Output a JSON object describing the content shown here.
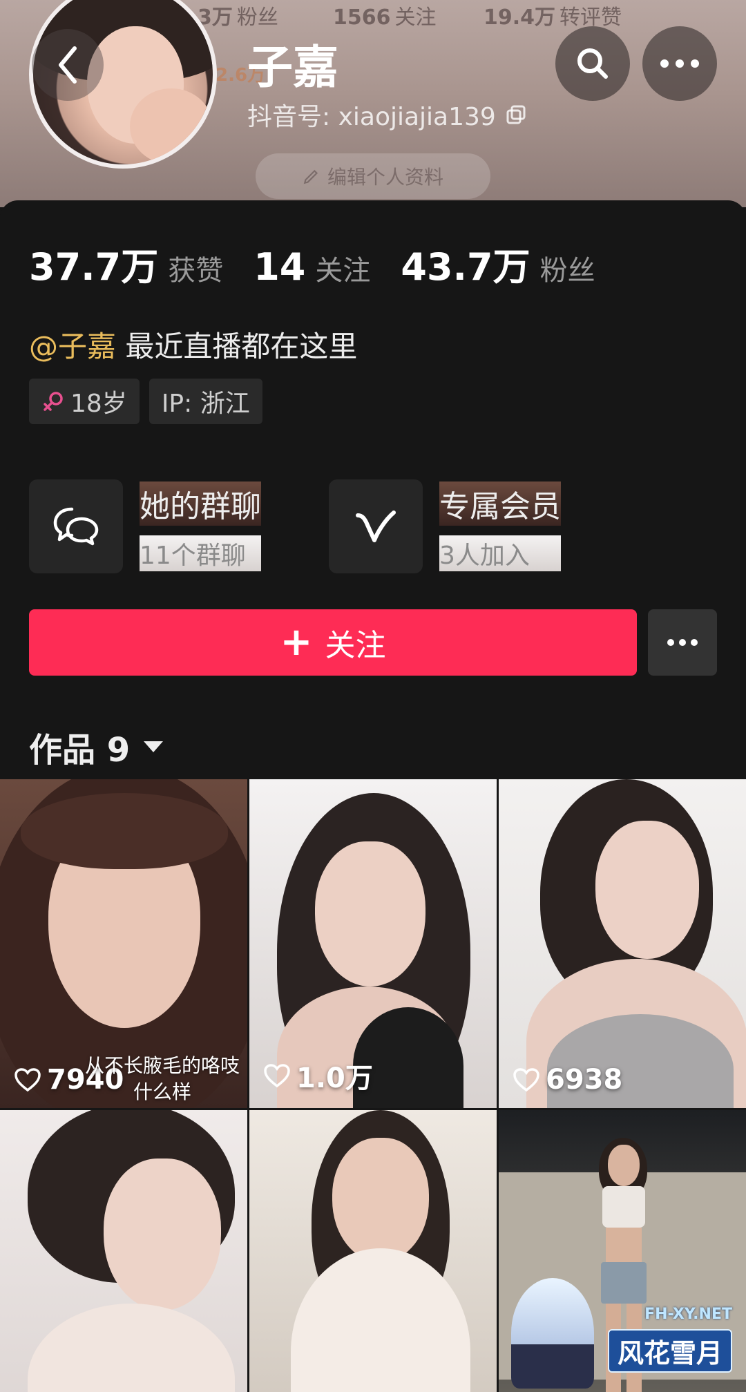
{
  "header": {
    "nickname": "子嘉",
    "douyin_id": "抖音号: xiaojiajia139",
    "bg_fans": "3万",
    "bg_fans_label": "粉丝",
    "bg_following": "1566",
    "bg_following_label": "关注",
    "bg_likes": "19.4万",
    "bg_likes_label": "转评赞",
    "bg_orange": "2.6万",
    "bg_edit_label": "编辑个人资料"
  },
  "stats": [
    {
      "num": "37.7万",
      "label": "获赞"
    },
    {
      "num": "14",
      "label": "关注"
    },
    {
      "num": "43.7万",
      "label": "粉丝"
    }
  ],
  "bio": {
    "mention": "@子嘉",
    "text": " 最近直播都在这里"
  },
  "tags": {
    "age": "18岁",
    "ip": "IP: 浙江"
  },
  "features": [
    {
      "title": "她的群聊",
      "subtitle": "11个群聊",
      "icon": "chat-bubbles-icon"
    },
    {
      "title": "专属会员",
      "subtitle": "3人加入",
      "icon": "vip-v-icon"
    }
  ],
  "actions": {
    "follow_label": "关注",
    "follow_plus": "+"
  },
  "works": {
    "title": "作品 9"
  },
  "tiles": [
    {
      "likes": "7940",
      "caption": "从不长腋毛的咯吱什么样"
    },
    {
      "likes": "1.0万",
      "caption": ""
    },
    {
      "likes": "6938",
      "caption": ""
    },
    {
      "likes": "",
      "caption": ""
    },
    {
      "likes": "",
      "caption": ""
    },
    {
      "likes": "",
      "caption": ""
    }
  ],
  "watermark": {
    "url": "FH-XY.NET",
    "name": "风花雪月"
  },
  "colors": {
    "accent": "#fe2c55",
    "mention": "#e9bc5c",
    "card_bg": "#161616"
  }
}
